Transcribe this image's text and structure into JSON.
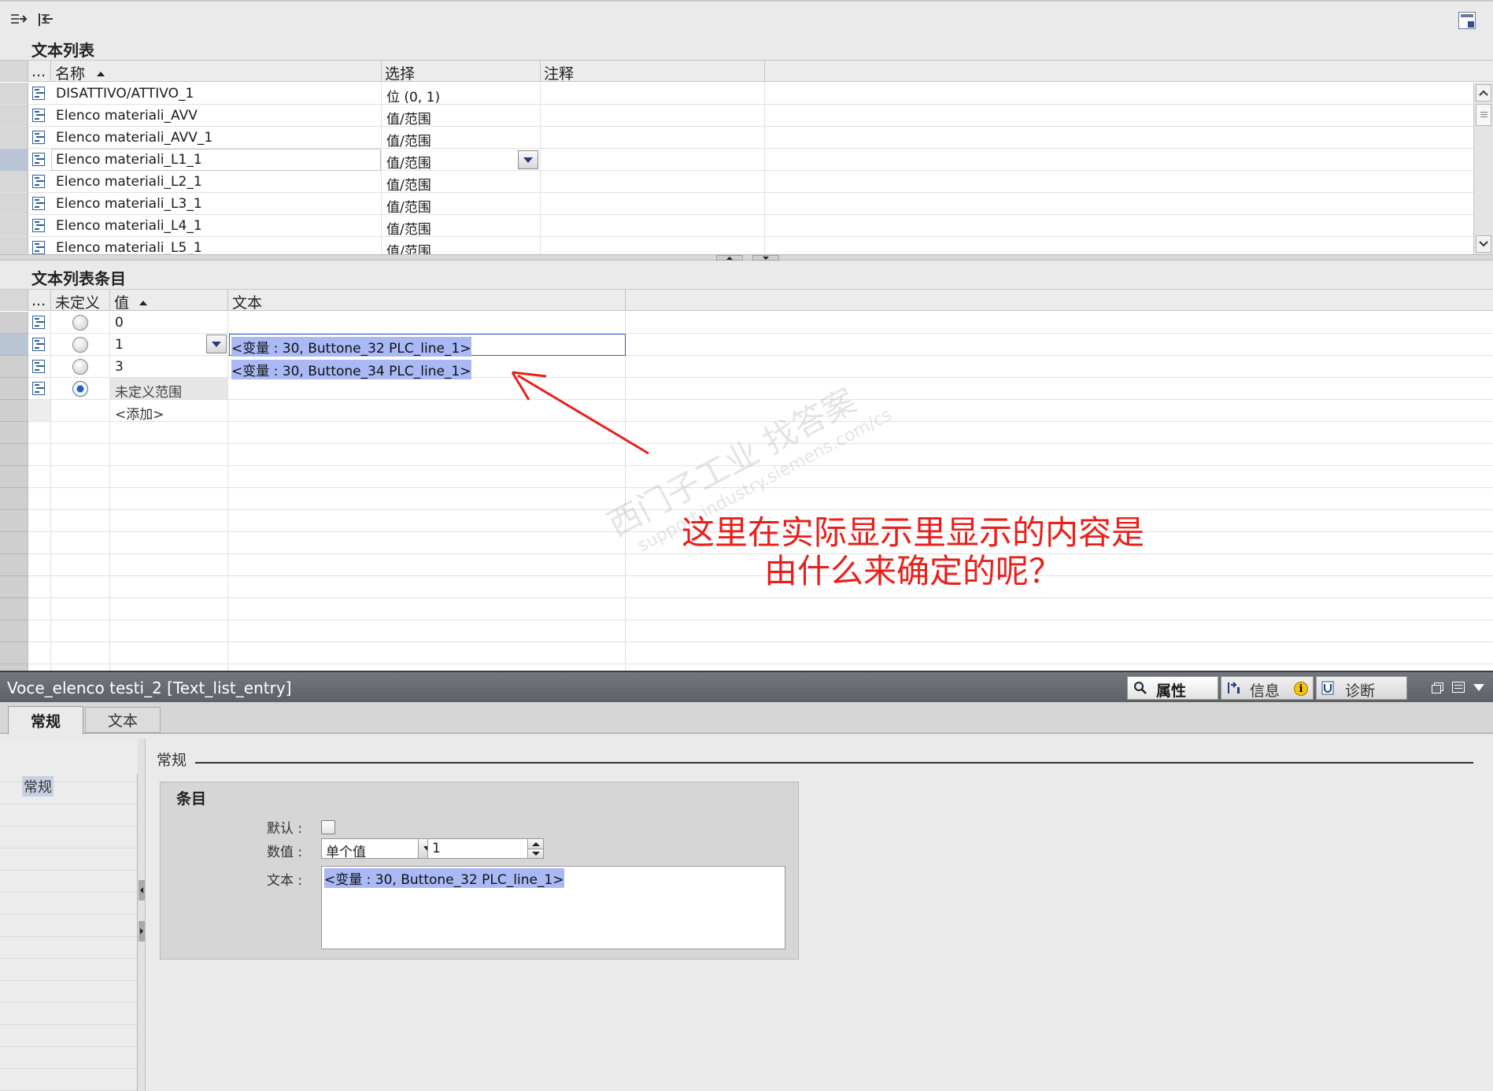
{
  "text_list": {
    "title": "文本列表",
    "columns": {
      "dots": "...",
      "name": "名称",
      "selection": "选择",
      "comment": "注释"
    },
    "rows": [
      {
        "name": "DISATTIVO/ATTIVO_1",
        "selection": "位 (0, 1)"
      },
      {
        "name": "Elenco materiali_AVV",
        "selection": "值/范围"
      },
      {
        "name": "Elenco materiali_AVV_1",
        "selection": "值/范围"
      },
      {
        "name": "Elenco materiali_L1_1",
        "selection": "值/范围"
      },
      {
        "name": "Elenco materiali_L2_1",
        "selection": "值/范围"
      },
      {
        "name": "Elenco materiali_L3_1",
        "selection": "值/范围"
      },
      {
        "name": "Elenco materiali_L4_1",
        "selection": "值/范围"
      },
      {
        "name": "Elenco materiali_L5_1",
        "selection": "值/范围"
      }
    ]
  },
  "entries": {
    "title": "文本列表条目",
    "columns": {
      "dots": "...",
      "undefined": "未定义",
      "value": "值",
      "text": "文本"
    },
    "rows": [
      {
        "value": "0",
        "text": "",
        "default": false
      },
      {
        "value": "1",
        "text": "<变量 : 30,  Buttone_32 PLC_line_1>",
        "default": false
      },
      {
        "value": "3",
        "text": "<变量 : 30,  Buttone_34 PLC_line_1>",
        "default": false
      },
      {
        "value": "未定义范围",
        "text": "",
        "default": true
      }
    ],
    "add_label": "<添加>"
  },
  "annotation": {
    "line1": "这里在实际显示里显示的内容是",
    "line2": "由什么来确定的呢？",
    "color": "#e8201b"
  },
  "watermark": {
    "line1": "西门子工业  找答案",
    "line2": "support.industry.siemens.com/cs"
  },
  "inspector": {
    "title": "Voce_elenco testi_2 [Text_list_entry]",
    "tabs": {
      "properties": "属性",
      "info": "信息",
      "diagnostics": "诊断"
    },
    "sub_tabs": {
      "general": "常规",
      "text": "文本"
    },
    "nav_general": "常规",
    "section_title": "常规",
    "group_title": "条目",
    "default_label": "默认 :",
    "value_label": "数值 :",
    "value_mode": "单个值",
    "value": "1",
    "text_label": "文本 :",
    "text_value": "<变量 : 30,  Buttone_32 PLC_line_1>"
  }
}
